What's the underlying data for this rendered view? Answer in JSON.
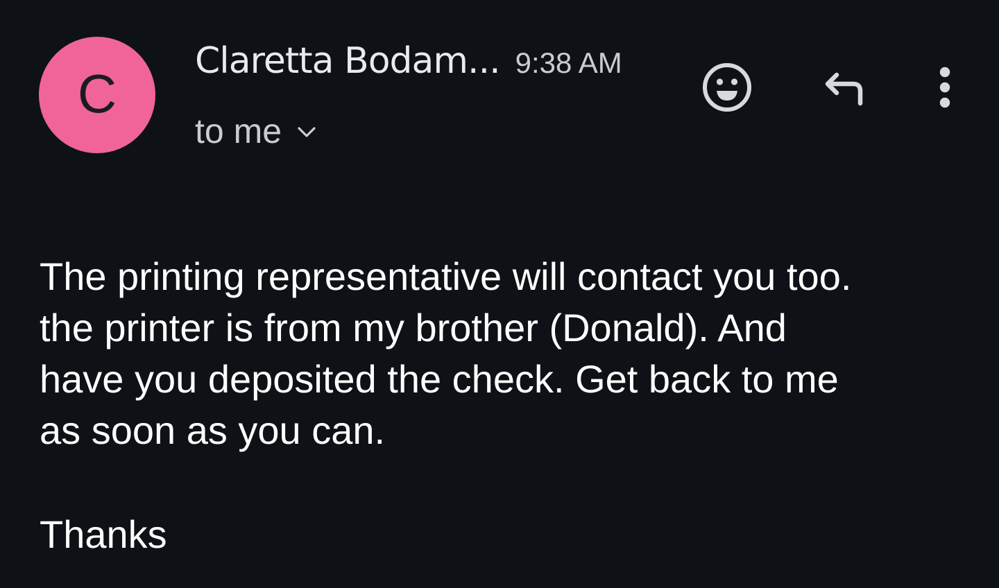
{
  "email": {
    "avatar_letter": "C",
    "avatar_color": "#f0649a",
    "sender_name": "Claretta Bodam...",
    "time": "9:38 AM",
    "recipient": "to me",
    "body": "The printing representative will contact you too.\nthe printer is from my brother (Donald). And\nhave you deposited the check. Get back to me\nas soon as you can.",
    "signoff": "Thanks"
  },
  "actions": {
    "emoji_icon": "emoji-react-icon",
    "reply_icon": "reply-icon",
    "more_icon": "more-vert-icon",
    "recipient_expand_icon": "chevron-down-icon"
  },
  "theme": {
    "background": "#0e1217",
    "text": "#ffffff",
    "secondary_text": "#c9ccd1"
  }
}
